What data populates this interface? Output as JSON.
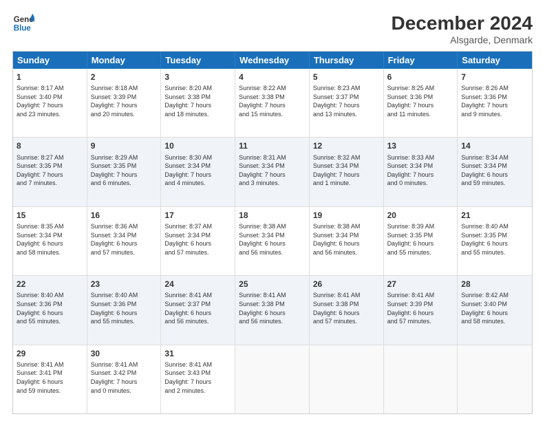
{
  "header": {
    "logo_line1": "General",
    "logo_line2": "Blue",
    "month_title": "December 2024",
    "location": "Alsgarde, Denmark"
  },
  "days_of_week": [
    "Sunday",
    "Monday",
    "Tuesday",
    "Wednesday",
    "Thursday",
    "Friday",
    "Saturday"
  ],
  "weeks": [
    [
      {
        "day": "1",
        "lines": [
          "Sunrise: 8:17 AM",
          "Sunset: 3:40 PM",
          "Daylight: 7 hours",
          "and 23 minutes."
        ]
      },
      {
        "day": "2",
        "lines": [
          "Sunrise: 8:18 AM",
          "Sunset: 3:39 PM",
          "Daylight: 7 hours",
          "and 20 minutes."
        ]
      },
      {
        "day": "3",
        "lines": [
          "Sunrise: 8:20 AM",
          "Sunset: 3:38 PM",
          "Daylight: 7 hours",
          "and 18 minutes."
        ]
      },
      {
        "day": "4",
        "lines": [
          "Sunrise: 8:22 AM",
          "Sunset: 3:38 PM",
          "Daylight: 7 hours",
          "and 15 minutes."
        ]
      },
      {
        "day": "5",
        "lines": [
          "Sunrise: 8:23 AM",
          "Sunset: 3:37 PM",
          "Daylight: 7 hours",
          "and 13 minutes."
        ]
      },
      {
        "day": "6",
        "lines": [
          "Sunrise: 8:25 AM",
          "Sunset: 3:36 PM",
          "Daylight: 7 hours",
          "and 11 minutes."
        ]
      },
      {
        "day": "7",
        "lines": [
          "Sunrise: 8:26 AM",
          "Sunset: 3:36 PM",
          "Daylight: 7 hours",
          "and 9 minutes."
        ]
      }
    ],
    [
      {
        "day": "8",
        "lines": [
          "Sunrise: 8:27 AM",
          "Sunset: 3:35 PM",
          "Daylight: 7 hours",
          "and 7 minutes."
        ]
      },
      {
        "day": "9",
        "lines": [
          "Sunrise: 8:29 AM",
          "Sunset: 3:35 PM",
          "Daylight: 7 hours",
          "and 6 minutes."
        ]
      },
      {
        "day": "10",
        "lines": [
          "Sunrise: 8:30 AM",
          "Sunset: 3:34 PM",
          "Daylight: 7 hours",
          "and 4 minutes."
        ]
      },
      {
        "day": "11",
        "lines": [
          "Sunrise: 8:31 AM",
          "Sunset: 3:34 PM",
          "Daylight: 7 hours",
          "and 3 minutes."
        ]
      },
      {
        "day": "12",
        "lines": [
          "Sunrise: 8:32 AM",
          "Sunset: 3:34 PM",
          "Daylight: 7 hours",
          "and 1 minute."
        ]
      },
      {
        "day": "13",
        "lines": [
          "Sunrise: 8:33 AM",
          "Sunset: 3:34 PM",
          "Daylight: 7 hours",
          "and 0 minutes."
        ]
      },
      {
        "day": "14",
        "lines": [
          "Sunrise: 8:34 AM",
          "Sunset: 3:34 PM",
          "Daylight: 6 hours",
          "and 59 minutes."
        ]
      }
    ],
    [
      {
        "day": "15",
        "lines": [
          "Sunrise: 8:35 AM",
          "Sunset: 3:34 PM",
          "Daylight: 6 hours",
          "and 58 minutes."
        ]
      },
      {
        "day": "16",
        "lines": [
          "Sunrise: 8:36 AM",
          "Sunset: 3:34 PM",
          "Daylight: 6 hours",
          "and 57 minutes."
        ]
      },
      {
        "day": "17",
        "lines": [
          "Sunrise: 8:37 AM",
          "Sunset: 3:34 PM",
          "Daylight: 6 hours",
          "and 57 minutes."
        ]
      },
      {
        "day": "18",
        "lines": [
          "Sunrise: 8:38 AM",
          "Sunset: 3:34 PM",
          "Daylight: 6 hours",
          "and 56 minutes."
        ]
      },
      {
        "day": "19",
        "lines": [
          "Sunrise: 8:38 AM",
          "Sunset: 3:34 PM",
          "Daylight: 6 hours",
          "and 56 minutes."
        ]
      },
      {
        "day": "20",
        "lines": [
          "Sunrise: 8:39 AM",
          "Sunset: 3:35 PM",
          "Daylight: 6 hours",
          "and 55 minutes."
        ]
      },
      {
        "day": "21",
        "lines": [
          "Sunrise: 8:40 AM",
          "Sunset: 3:35 PM",
          "Daylight: 6 hours",
          "and 55 minutes."
        ]
      }
    ],
    [
      {
        "day": "22",
        "lines": [
          "Sunrise: 8:40 AM",
          "Sunset: 3:36 PM",
          "Daylight: 6 hours",
          "and 55 minutes."
        ]
      },
      {
        "day": "23",
        "lines": [
          "Sunrise: 8:40 AM",
          "Sunset: 3:36 PM",
          "Daylight: 6 hours",
          "and 55 minutes."
        ]
      },
      {
        "day": "24",
        "lines": [
          "Sunrise: 8:41 AM",
          "Sunset: 3:37 PM",
          "Daylight: 6 hours",
          "and 56 minutes."
        ]
      },
      {
        "day": "25",
        "lines": [
          "Sunrise: 8:41 AM",
          "Sunset: 3:38 PM",
          "Daylight: 6 hours",
          "and 56 minutes."
        ]
      },
      {
        "day": "26",
        "lines": [
          "Sunrise: 8:41 AM",
          "Sunset: 3:38 PM",
          "Daylight: 6 hours",
          "and 57 minutes."
        ]
      },
      {
        "day": "27",
        "lines": [
          "Sunrise: 8:41 AM",
          "Sunset: 3:39 PM",
          "Daylight: 6 hours",
          "and 57 minutes."
        ]
      },
      {
        "day": "28",
        "lines": [
          "Sunrise: 8:42 AM",
          "Sunset: 3:40 PM",
          "Daylight: 6 hours",
          "and 58 minutes."
        ]
      }
    ],
    [
      {
        "day": "29",
        "lines": [
          "Sunrise: 8:41 AM",
          "Sunset: 3:41 PM",
          "Daylight: 6 hours",
          "and 59 minutes."
        ]
      },
      {
        "day": "30",
        "lines": [
          "Sunrise: 8:41 AM",
          "Sunset: 3:42 PM",
          "Daylight: 7 hours",
          "and 0 minutes."
        ]
      },
      {
        "day": "31",
        "lines": [
          "Sunrise: 8:41 AM",
          "Sunset: 3:43 PM",
          "Daylight: 7 hours",
          "and 2 minutes."
        ]
      },
      {
        "day": "",
        "lines": []
      },
      {
        "day": "",
        "lines": []
      },
      {
        "day": "",
        "lines": []
      },
      {
        "day": "",
        "lines": []
      }
    ]
  ]
}
